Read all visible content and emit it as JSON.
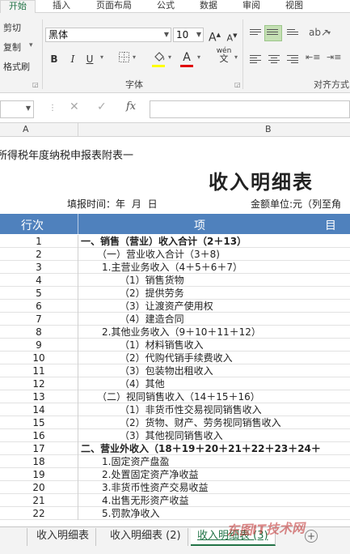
{
  "ribbon": {
    "tabs": [
      "开始",
      "插入",
      "页面布局",
      "公式",
      "数据",
      "审阅",
      "视图"
    ],
    "clipboard": {
      "cut": "剪切",
      "copy": "复制",
      "copy_arrow": "▾",
      "format_painter": "格式刷"
    },
    "font": {
      "name": "黑体",
      "size": "10",
      "grow": "A",
      "shrink": "A",
      "bold": "B",
      "italic": "I",
      "underline": "U",
      "font_color_label": "A",
      "pinyin": "wén",
      "group_label": "字体"
    },
    "alignment": {
      "group_label": "对齐方式"
    },
    "colors": {
      "fill": "#ffff00",
      "font": "#e00000",
      "accent": "#217346"
    }
  },
  "formula_bar": {
    "fx": "fx",
    "cancel": "✕",
    "enter": "✓"
  },
  "columns": {
    "a": "A",
    "b": "B"
  },
  "sheet": {
    "annex_title": "企业所得税年度纳税申报表附表一",
    "main_title": "收入明细表",
    "fill_time": "填报时间：年 月 日",
    "amount_unit": "金额单位:元（列至角",
    "header_row": "行次",
    "header_item": "项",
    "header_item_end": "目",
    "rows": [
      {
        "num": "1",
        "item": "一、销售（营业）收入合计（2＋13）",
        "bold": true,
        "indent": 0
      },
      {
        "num": "2",
        "item": "（一）营业收入合计（3＋8)",
        "indent": 1
      },
      {
        "num": "3",
        "item": "1.主营业务收入（4＋5＋6＋7）",
        "indent": 2
      },
      {
        "num": "4",
        "item": "（1）销售货物",
        "indent": 3
      },
      {
        "num": "5",
        "item": "（2）提供劳务",
        "indent": 3
      },
      {
        "num": "6",
        "item": "（3）让渡资产使用权",
        "indent": 3
      },
      {
        "num": "7",
        "item": "（4）建造合同",
        "indent": 3
      },
      {
        "num": "8",
        "item": "2.其他业务收入（9＋10＋11＋12）",
        "indent": 2
      },
      {
        "num": "9",
        "item": "（1）材料销售收入",
        "indent": 3
      },
      {
        "num": "10",
        "item": "（2）代购代销手续费收入",
        "indent": 3
      },
      {
        "num": "11",
        "item": "（3）包装物出租收入",
        "indent": 3
      },
      {
        "num": "12",
        "item": "（4）其他",
        "indent": 3
      },
      {
        "num": "13",
        "item": "（二）视同销售收入（14＋15＋16）",
        "indent": 1
      },
      {
        "num": "14",
        "item": "（1）非货币性交易视同销售收入",
        "indent": 3
      },
      {
        "num": "15",
        "item": "（2）货物、财产、劳务视同销售收入",
        "indent": 3
      },
      {
        "num": "16",
        "item": "（3）其他视同销售收入",
        "indent": 3
      },
      {
        "num": "17",
        "item": "二、营业外收入（18＋19＋20＋21＋22＋23＋24＋",
        "bold": true,
        "indent": 0
      },
      {
        "num": "18",
        "item": "1.固定资产盘盈",
        "indent": 2
      },
      {
        "num": "19",
        "item": "2.处置固定资产净收益",
        "indent": 2
      },
      {
        "num": "20",
        "item": "3.非货币性资产交易收益",
        "indent": 2
      },
      {
        "num": "21",
        "item": "4.出售无形资产收益",
        "indent": 2
      },
      {
        "num": "22",
        "item": "5.罚款净收入",
        "indent": 2
      }
    ]
  },
  "sheet_tabs": [
    "收入明细表",
    "收入明细表 (2)",
    "收入明细表 (3)"
  ],
  "add_sheet": "+",
  "watermark": "东图IT技术网"
}
